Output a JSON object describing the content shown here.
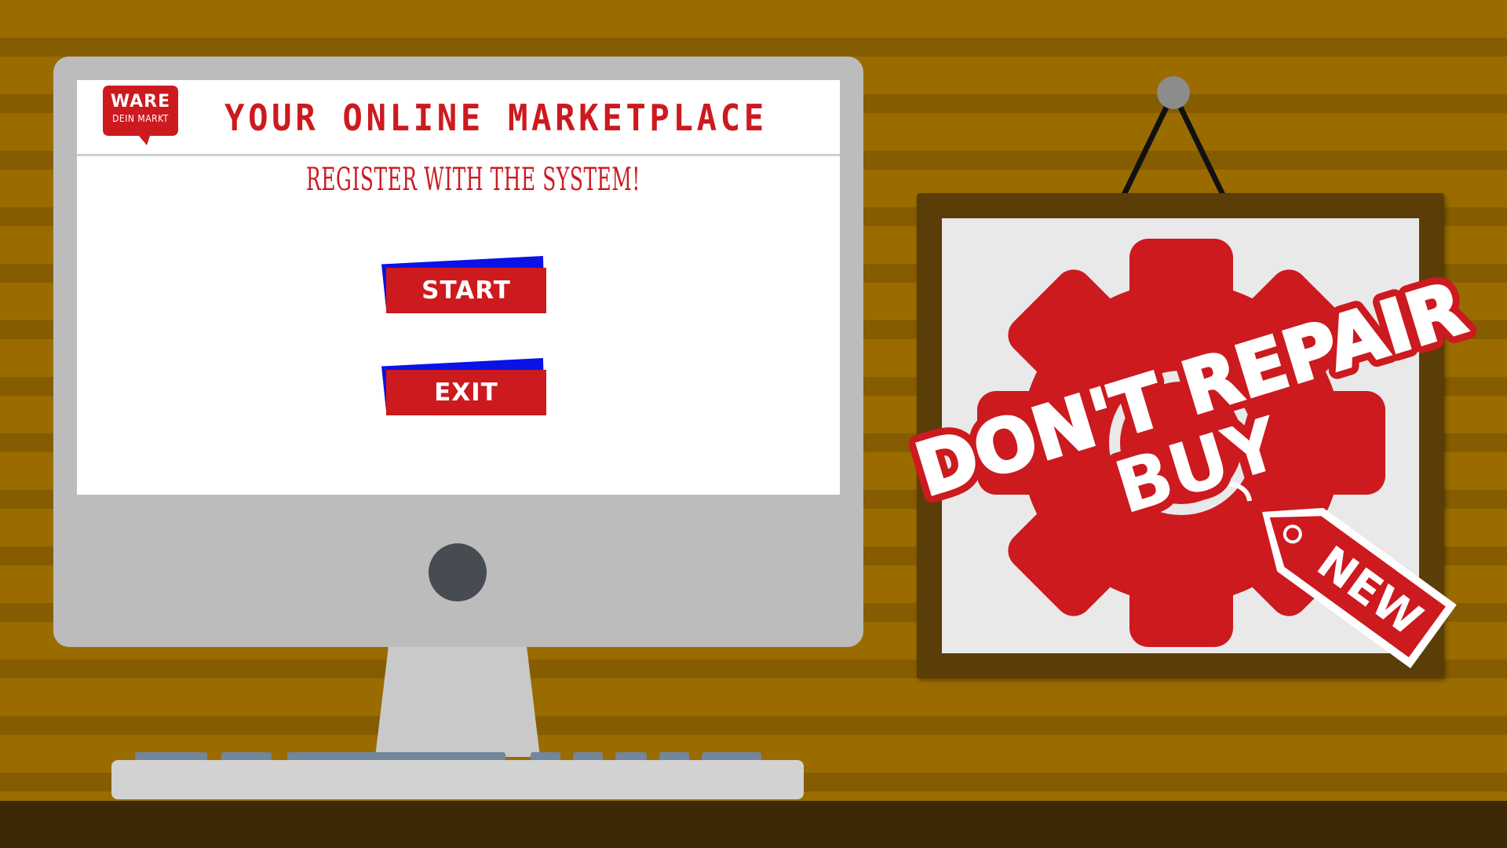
{
  "screen": {
    "logo": {
      "main": "WARE",
      "sub": "DEIN MARKT"
    },
    "title": "YOUR ONLINE MARKETPLACE",
    "subtitle": "REGISTER WITH THE SYSTEM!",
    "buttons": {
      "start": "START",
      "exit": "EXIT"
    }
  },
  "poster": {
    "line1": "DON'T REPAIR",
    "line2": "BUY",
    "tag": "NEW"
  },
  "colors": {
    "brand_red": "#cc1a1f",
    "button_shadow_blue": "#0a12e6",
    "wall_light": "#9a6c00",
    "wall_dark": "#855c00",
    "frame_brown": "#5b3d08"
  }
}
